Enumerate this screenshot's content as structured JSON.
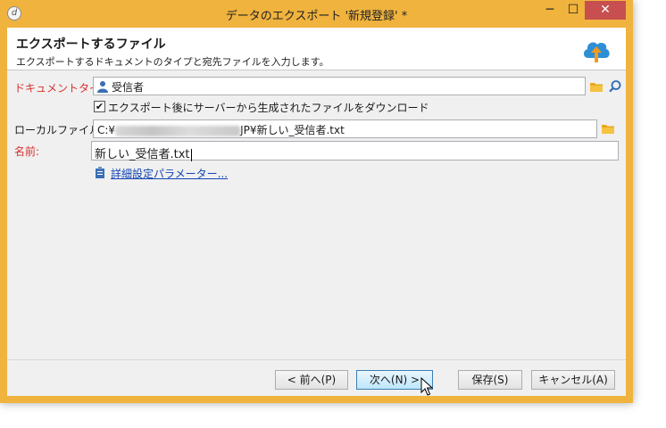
{
  "window": {
    "title": "データのエクスポート '新規登録' *",
    "app_icon_glyph": "d",
    "minimize_glyph": "─",
    "maximize_glyph": "☐",
    "close_glyph": "✕"
  },
  "header": {
    "title": "エクスポートするファイル",
    "subtitle": "エクスポートするドキュメントのタイプと宛先ファイルを入力します。",
    "icon": "cloud-upload-icon"
  },
  "form": {
    "doc_type": {
      "label": "ドキュメントタイプ:",
      "value": "受信者"
    },
    "download_checkbox": {
      "label": "エクスポート後にサーバーから生成されたファイルをダウンロード",
      "checked": true,
      "mark": "✔"
    },
    "local_file": {
      "label": "ローカルファイル:",
      "prefix": "C:¥",
      "suffix": "JP¥新しい_受信者.txt"
    },
    "name": {
      "label": "名前:",
      "value": "新しい_受信者.txt"
    },
    "advanced_link": "詳細設定パラメーター..."
  },
  "buttons": {
    "prev": "< 前へ(P)",
    "next": "次へ(N) >",
    "save": "保存(S)",
    "cancel": "キャンセル(A)"
  },
  "colors": {
    "titlebar": "#f0b33e",
    "required_label": "#d83030",
    "link": "#1545b3"
  }
}
